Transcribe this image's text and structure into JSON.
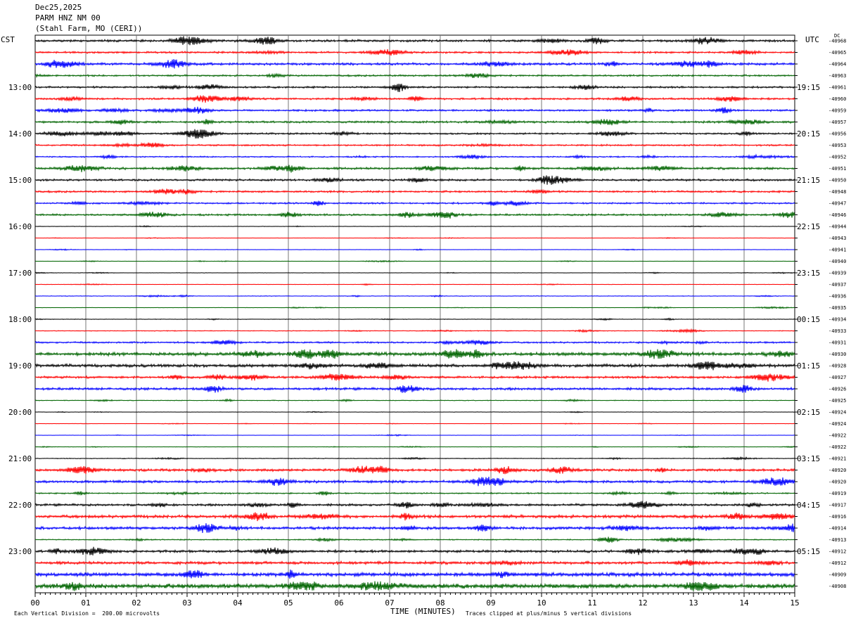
{
  "header": {
    "date": "Dec25,2025",
    "station": "PARM HNZ NM 00",
    "location": "(Stahl Farm, MO (CERI))"
  },
  "labels": {
    "left_zone": "CST",
    "right_zone": "UTC",
    "dc": "DC",
    "xlabel": "TIME (MINUTES)",
    "scale_note": "Each Vertical Division =  200.00 microvolts",
    "clip_note": "Traces clipped at plus/minus 5 vertical divisions"
  },
  "chart_data": {
    "type": "line",
    "title": "PARM HNZ NM 00",
    "xlabel": "TIME (MINUTES)",
    "xlim": [
      0,
      15
    ],
    "x_ticks": [
      "00",
      "01",
      "02",
      "03",
      "04",
      "05",
      "06",
      "07",
      "08",
      "09",
      "10",
      "11",
      "12",
      "13",
      "14",
      "15"
    ],
    "left_hour_labels": [
      "13:00",
      "14:00",
      "15:00",
      "16:00",
      "17:00",
      "18:00",
      "19:00",
      "20:00",
      "21:00",
      "22:00",
      "23:00"
    ],
    "right_hour_labels": [
      "19:15",
      "20:15",
      "21:15",
      "22:15",
      "23:15",
      "00:15",
      "01:15",
      "02:15",
      "03:15",
      "04:15",
      "05:15"
    ],
    "trace_colors": [
      "#000000",
      "#ff0000",
      "#0000ff",
      "#006400"
    ],
    "dc_offsets": [
      "-40968",
      "-40965",
      "-40964",
      "-40963",
      "-40961",
      "-40960",
      "-40959",
      "-40957",
      "-40956",
      "-40953",
      "-40952",
      "-40951",
      "-40950",
      "-40948",
      "-40947",
      "-40946",
      "-40944",
      "-40943",
      "-40941",
      "-40940",
      "-40939",
      "-40937",
      "-40936",
      "-40935",
      "-40934",
      "-40933",
      "-40931",
      "-40930",
      "-40928",
      "-40927",
      "-40926",
      "-40925",
      "-40924",
      "-40924",
      "-40922",
      "-40922",
      "-40921",
      "-40920",
      "-40920",
      "-40919",
      "-40917",
      "-40916",
      "-40914",
      "-40913",
      "-40912",
      "-40912",
      "-40909",
      "-40908"
    ],
    "trace_amplitude": [
      1.2,
      1.0,
      1.3,
      0.9,
      1.0,
      1.0,
      1.0,
      1.1,
      0.9,
      0.9,
      0.7,
      1.2,
      1.1,
      1.0,
      0.9,
      1.0,
      0.25,
      0.2,
      0.2,
      0.2,
      0.2,
      0.25,
      0.3,
      0.2,
      0.3,
      0.4,
      0.9,
      1.8,
      1.6,
      1.2,
      1.3,
      0.4,
      0.2,
      0.15,
      0.15,
      0.25,
      0.4,
      1.3,
      1.4,
      0.7,
      1.2,
      1.6,
      1.5,
      0.6,
      1.3,
      1.5,
      2.0,
      2.5
    ],
    "scale_microvolts_per_division": 200.0,
    "clip_divisions": 5
  }
}
